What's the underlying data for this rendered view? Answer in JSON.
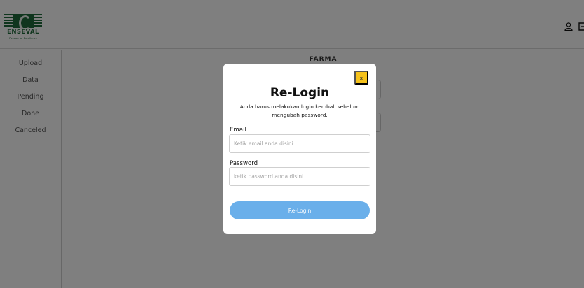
{
  "brand": {
    "name": "ENSEVAL",
    "tagline": "Passion for Excellence",
    "colors": {
      "primary": "#1f6a3a"
    }
  },
  "header": {
    "icons": [
      "user-icon",
      "logout-icon"
    ]
  },
  "sidebar": {
    "items": [
      {
        "label": "Upload"
      },
      {
        "label": "Data"
      },
      {
        "label": "Pending"
      },
      {
        "label": "Done"
      },
      {
        "label": "Canceled"
      }
    ]
  },
  "main": {
    "heading": "FARMA"
  },
  "modal": {
    "close_label": "x",
    "title": "Re-Login",
    "message": "Anda harus melakukan login kembali sebelum mengubah password.",
    "email": {
      "label": "Email",
      "value": "",
      "placeholder": "Ketik email anda disini"
    },
    "password": {
      "label": "Password",
      "value": "",
      "placeholder": "ketik password anda disini"
    },
    "submit_label": "Re-Login",
    "colors": {
      "close_button": "#f5c21b",
      "submit_button": "#6aafea"
    }
  }
}
